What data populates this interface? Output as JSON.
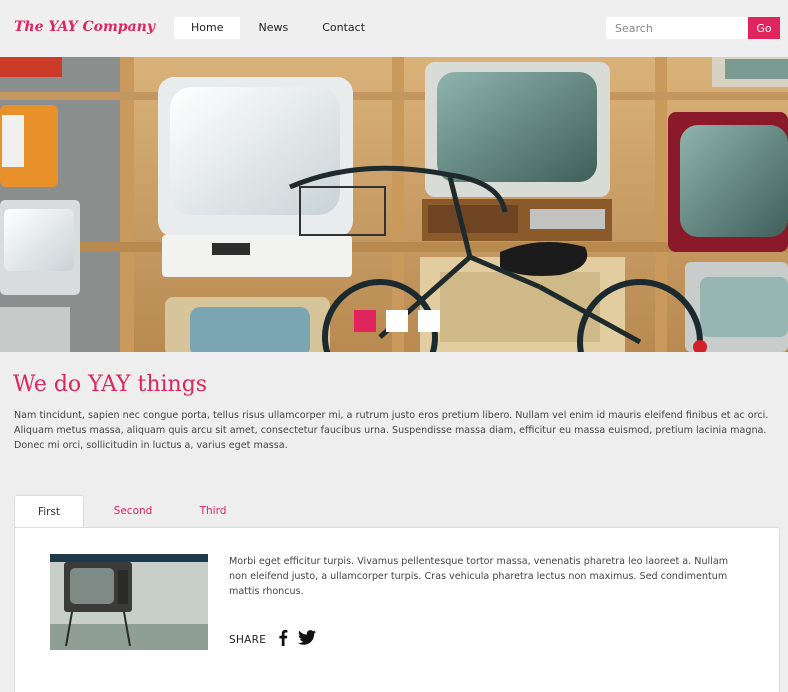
{
  "brand": {
    "logo_text": "The YAY Company",
    "accent_color": "#e0245e"
  },
  "nav": {
    "items": [
      {
        "label": "Home",
        "active": true
      },
      {
        "label": "News",
        "active": false
      },
      {
        "label": "Contact",
        "active": false
      }
    ]
  },
  "search": {
    "placeholder": "Search",
    "value": "",
    "button_label": "Go"
  },
  "hero": {
    "slides": [
      {
        "active": true
      },
      {
        "active": false
      },
      {
        "active": false
      }
    ]
  },
  "intro": {
    "title": "We do YAY things",
    "text": "Nam tincidunt, sapien nec congue porta, tellus risus ullamcorper mi, a rutrum justo eros pretium libero. Nullam vel enim id mauris eleifend finibus et ac orci. Aliquam metus massa, aliquam quis arcu sit amet, consectetur faucibus urna. Suspendisse massa diam, efficitur eu massa euismod, pretium lacinia magna. Donec mi orci, sollicitudin in luctus a, varius eget massa."
  },
  "tabs": {
    "items": [
      {
        "label": "First",
        "active": true
      },
      {
        "label": "Second",
        "active": false
      },
      {
        "label": "Third",
        "active": false
      }
    ]
  },
  "panel": {
    "text": "Morbi eget efficitur turpis. Vivamus pellentesque tortor massa, venenatis pharetra leo laoreet a. Nullam non eleifend justo, a ullamcorper turpis. Cras vehicula pharetra lectus non maximus. Sed condimentum mattis rhoncus.",
    "share_label": "SHARE",
    "share_icons": [
      "facebook-icon",
      "twitter-icon"
    ]
  }
}
